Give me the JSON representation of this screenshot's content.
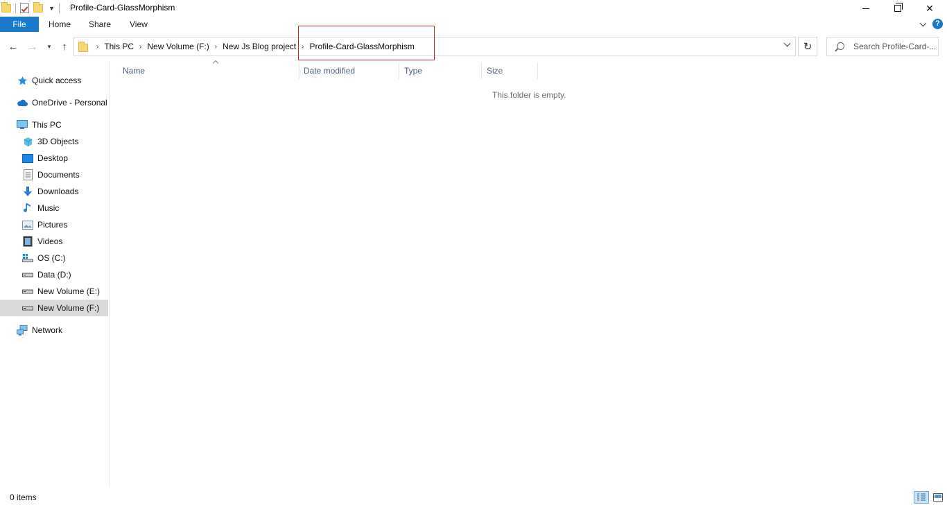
{
  "window": {
    "title": "Profile-Card-GlassMorphism",
    "minimize_symbol": "—",
    "close_symbol": "✕"
  },
  "ribbon": {
    "tabs": [
      "File",
      "Home",
      "Share",
      "View"
    ]
  },
  "address": {
    "crumbs": [
      "This PC",
      "New Volume (F:)",
      "New Js Blog project",
      "Profile-Card-GlassMorphism"
    ],
    "separator": "›",
    "search_placeholder": "Search Profile-Card-...",
    "refresh_symbol": "↻",
    "back_symbol": "←",
    "forward_symbol": "→",
    "up_symbol": "↑",
    "recent_symbol": "⌄"
  },
  "navpane": {
    "items": [
      {
        "label": "Quick access",
        "icon": "star-icon"
      },
      {
        "label": "OneDrive - Personal",
        "icon": "cloud-icon"
      },
      {
        "label": "This PC",
        "icon": "computer-icon"
      },
      {
        "label": "3D Objects",
        "icon": "cube-icon"
      },
      {
        "label": "Desktop",
        "icon": "desktop-icon"
      },
      {
        "label": "Documents",
        "icon": "document-icon"
      },
      {
        "label": "Downloads",
        "icon": "download-arrow-icon"
      },
      {
        "label": "Music",
        "icon": "music-note-icon"
      },
      {
        "label": "Pictures",
        "icon": "picture-icon"
      },
      {
        "label": "Videos",
        "icon": "film-icon"
      },
      {
        "label": "OS (C:)",
        "icon": "windows-drive-icon"
      },
      {
        "label": "Data (D:)",
        "icon": "drive-icon"
      },
      {
        "label": "New Volume (E:)",
        "icon": "drive-icon"
      },
      {
        "label": "New Volume (F:)",
        "icon": "drive-icon",
        "selected": true
      },
      {
        "label": "Network",
        "icon": "network-icon"
      }
    ]
  },
  "content": {
    "columns": [
      "Name",
      "Date modified",
      "Type",
      "Size"
    ],
    "empty_message": "This folder is empty."
  },
  "status": {
    "item_count": "0 items"
  },
  "colors": {
    "accent": "#1979ca",
    "highlight_border": "#d32020",
    "selected_bg": "#d9d9d9",
    "column_text": "#4c607a"
  }
}
